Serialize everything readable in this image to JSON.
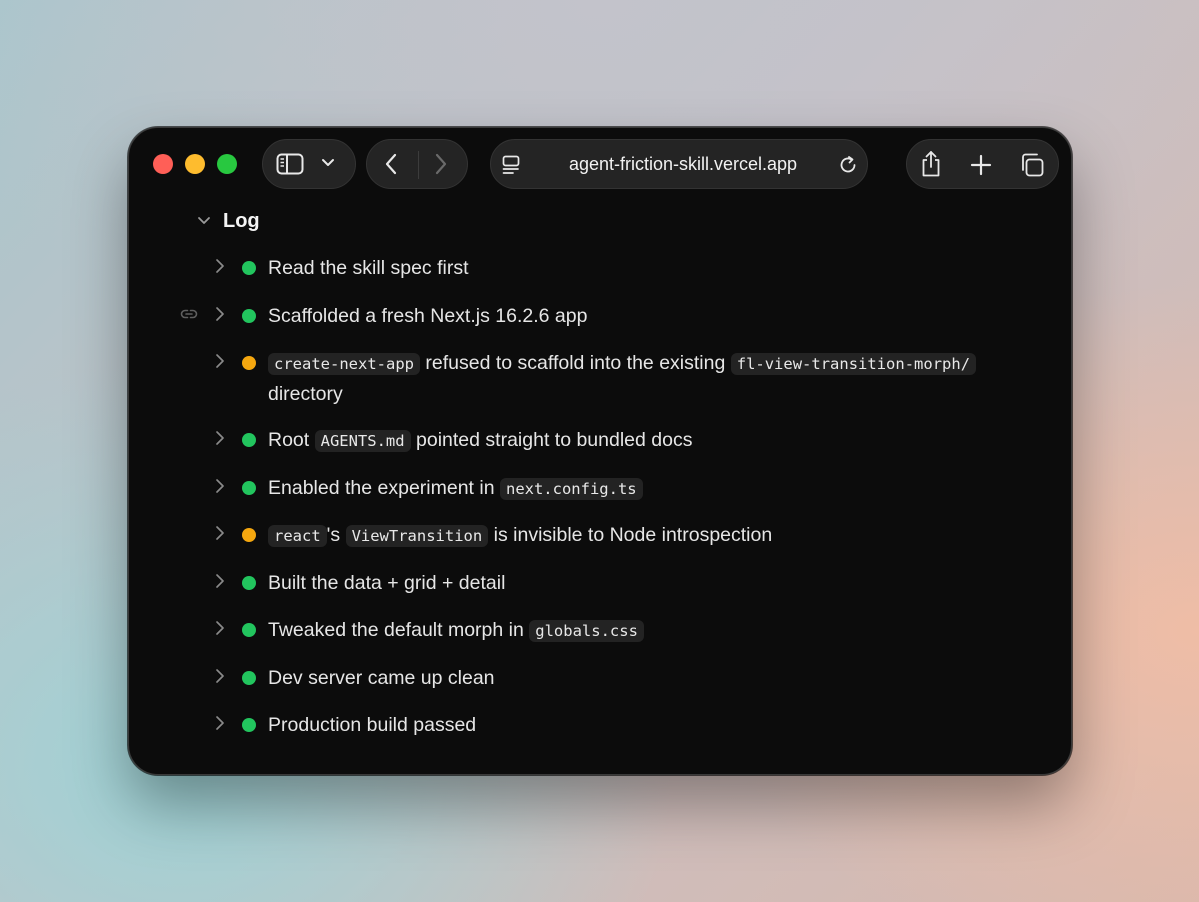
{
  "browser": {
    "url": "agent-friction-skill.vercel.app"
  },
  "section": {
    "title": "Log"
  },
  "colors": {
    "success": "#22c55e",
    "warning": "#f5a70f"
  },
  "items": [
    {
      "status": "success",
      "parts": [
        "Read the skill spec first"
      ]
    },
    {
      "status": "success",
      "parts": [
        "Scaffolded a fresh Next.js 16.2.6 app"
      ]
    },
    {
      "status": "warning",
      "parts": [
        "create-next-app",
        " refused to scaffold into the existing ",
        "fl-view-transition-morph/",
        " directory"
      ]
    },
    {
      "status": "success",
      "parts": [
        "Root ",
        "AGENTS.md",
        " pointed straight to bundled docs"
      ]
    },
    {
      "status": "success",
      "parts": [
        "Enabled the experiment in ",
        "next.config.ts"
      ]
    },
    {
      "status": "warning",
      "parts": [
        "react",
        "'s ",
        "ViewTransition",
        " is invisible to Node introspection"
      ]
    },
    {
      "status": "success",
      "parts": [
        "Built the data + grid + detail"
      ]
    },
    {
      "status": "success",
      "parts": [
        "Tweaked the default morph in ",
        "globals.css"
      ]
    },
    {
      "status": "success",
      "parts": [
        "Dev server came up clean"
      ]
    },
    {
      "status": "success",
      "parts": [
        "Production build passed"
      ]
    }
  ]
}
